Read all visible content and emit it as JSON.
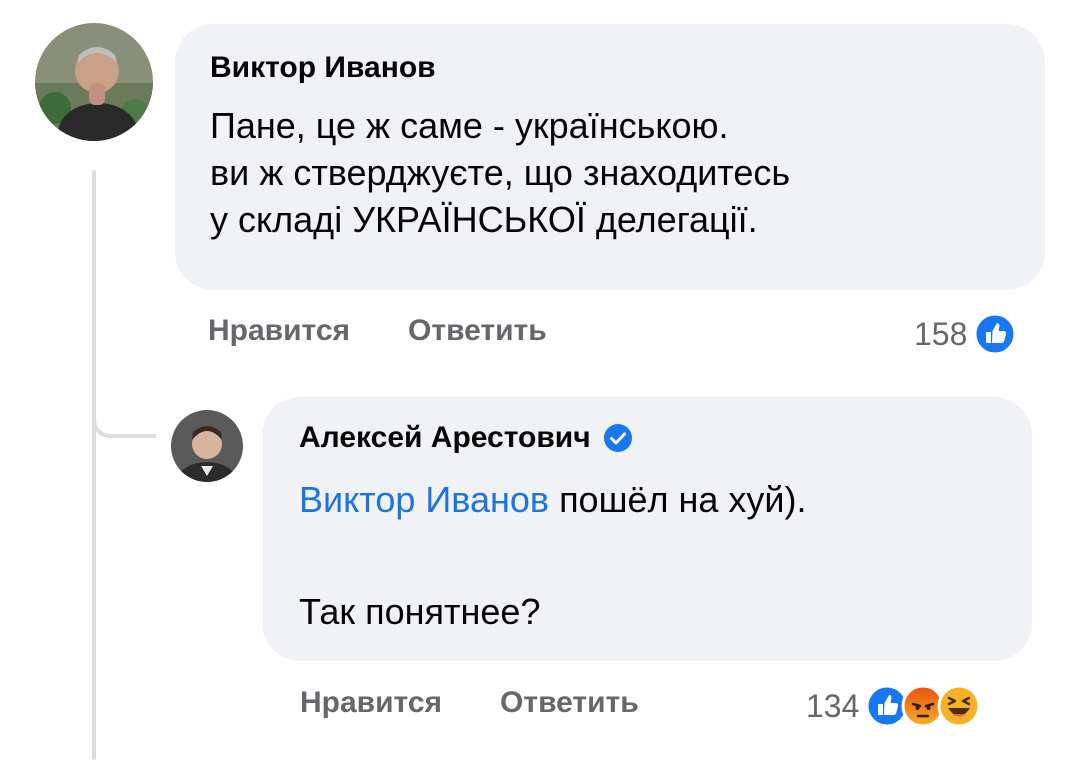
{
  "comments": [
    {
      "author": "Виктор Иванов",
      "lines": "Пане, це ж саме - українською.\nви ж стверджуєте, що знаходитесь\nу складі УКРАЇНСЬКОЇ делегації.",
      "like_label": "Нравится",
      "reply_label": "Ответить",
      "reaction_count": "158",
      "reactions": [
        "like-icon"
      ]
    },
    {
      "author": "Алексей Арестович",
      "verified": true,
      "mention": "Виктор Иванов",
      "text_after_mention": " пошёл на хуй).",
      "text_second": "Так понятнее?",
      "like_label": "Нравится",
      "reply_label": "Ответить",
      "reaction_count": "134",
      "reactions": [
        "like-icon",
        "angry-icon",
        "haha-icon"
      ]
    }
  ],
  "colors": {
    "bubble": "#f0f2f5",
    "mention": "#1b74e4",
    "secondary_text": "#65676b",
    "like_blue": "#1877f2",
    "angry_orange": "#e9710f",
    "haha_yellow": "#f7b125"
  }
}
